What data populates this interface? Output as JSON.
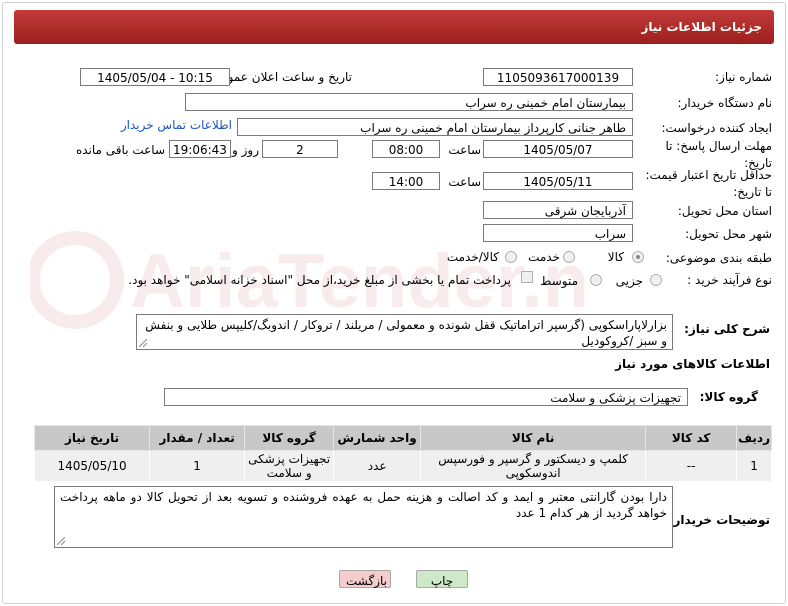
{
  "header": {
    "title": "جزئیات اطلاعات نیاز"
  },
  "fields": {
    "need_number_label": "شماره نیاز:",
    "need_number": "1105093617000139",
    "announce_label": "تاریخ و ساعت اعلان عمومی:",
    "announce_value": "1405/05/04 - 10:15",
    "buyer_org_label": "نام دستگاه خریدار:",
    "buyer_org": "بیمارستان امام خمینی ره  سراب",
    "creator_label": "ایجاد کننده درخواست:",
    "creator": "طاهر جنانی کارپرداز بیمارستان امام خمینی ره  سراب",
    "contact_link": "اطلاعات تماس خریدار",
    "deadline_label": "مهلت ارسال پاسخ: تا تاریخ:",
    "deadline_date": "1405/05/07",
    "deadline_time_label": "ساعت",
    "deadline_time": "08:00",
    "days_value": "2",
    "days_label": "روز و",
    "remaining_time": "19:06:43",
    "remaining_label": "ساعت باقی مانده",
    "validity_label": "حداقل تاریخ اعتبار قیمت: تا تاریخ:",
    "validity_date": "1405/05/11",
    "validity_time_label": "ساعت",
    "validity_time": "14:00",
    "province_label": "استان محل تحویل:",
    "province": "آذربایجان شرقی",
    "city_label": "شهر محل تحویل:",
    "city": "سراب",
    "category_label": "طبقه بندی موضوعی:",
    "category_options": [
      "کالا",
      "خدمت",
      "کالا/خدمت"
    ],
    "process_label": "نوع فرآیند خرید :",
    "process_options": [
      "جزیی",
      "متوسط"
    ],
    "payment_note": "پرداخت تمام یا بخشی از مبلغ خرید،از محل \"اسناد خزانه اسلامی\" خواهد بود."
  },
  "description": {
    "label": "شرح کلی نیاز:",
    "text": "بزارلاپاراسکوپی (گرسپر اتراماتیک قفل شونده و معمولی / مریلند / تروکار / اندوبگ/کلیپس طلایی و بنفش و سبز /کروکودیل"
  },
  "goods_section": {
    "title": "اطلاعات کالاهای مورد نیاز",
    "group_label": "گروه کالا:",
    "group_value": "تجهیزات پزشکی و سلامت"
  },
  "table": {
    "headers": [
      "ردیف",
      "کد کالا",
      "نام کالا",
      "واحد شمارش",
      "گروه کالا",
      "تعداد / مقدار",
      "تاریخ نیاز"
    ],
    "rows": [
      [
        "1",
        "--",
        "کلمپ و دیسکتور و گرسپر و فورسپس اندوسکوپی",
        "عدد",
        "تجهیزات پزشکی و سلامت",
        "1",
        "1405/05/10"
      ]
    ]
  },
  "buyer_notes": {
    "label": "توضیحات خریدار:",
    "text": "دارا بودن گارانتی معتبر و ایمد و کد اصالت و هزینه حمل به عهده فروشنده و تسویه بعد از تحویل کالا دو ماهه پرداخت خواهد  گردید از هر  کدام  1 عدد"
  },
  "buttons": {
    "print": "چاپ",
    "back": "بازگشت"
  },
  "watermark": {
    "text": "AriaTender.net"
  },
  "colors": {
    "header": "#b32d2b",
    "link": "#1a56c4",
    "table_header": "#c8c8c8",
    "print_btn": "#cfe8c8",
    "back_btn": "#f4cccc"
  }
}
